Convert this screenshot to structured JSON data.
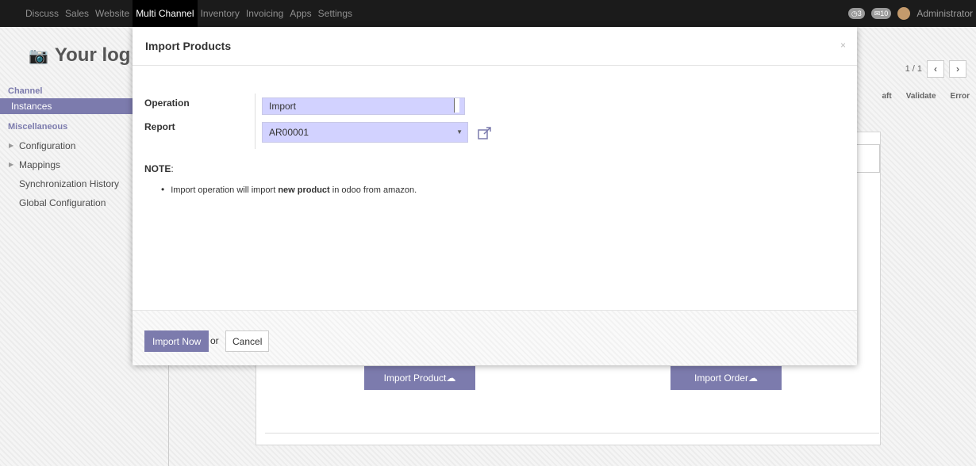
{
  "topbar": {
    "menu": [
      "Discuss",
      "Sales",
      "Website",
      "Multi Channel",
      "Inventory",
      "Invoicing",
      "Apps",
      "Settings"
    ],
    "active_index": 3,
    "badge_one": "3",
    "badge_two": "10",
    "user": "Administrator"
  },
  "background": {
    "logo_text": "Your log",
    "sidebar": {
      "channel_head": "Channel",
      "instances": "Instances",
      "misc_head": "Miscellaneous",
      "configuration": "Configuration",
      "mappings": "Mappings",
      "sync_history": "Synchronization History",
      "global_config": "Global Configuration"
    },
    "pager": "1 / 1",
    "status": [
      "aft",
      "Validate",
      "Error"
    ],
    "import_product_btn": "Import Product",
    "import_order_btn": "Import Order"
  },
  "modal": {
    "title": "Import Products",
    "close": "×",
    "operation_label": "Operation",
    "operation_value": "Import",
    "report_label": "Report",
    "report_value": "AR00001",
    "note_label": "NOTE",
    "note_pre": "Import operation will import ",
    "note_bold": "new product",
    "note_post": " in odoo from amazon.",
    "import_now": "Import Now",
    "or": "or",
    "cancel": "Cancel"
  }
}
